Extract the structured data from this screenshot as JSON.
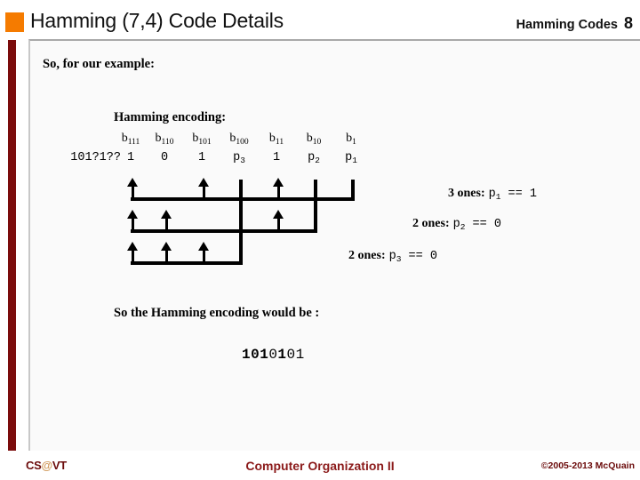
{
  "header": {
    "title": "Hamming (7,4) Code Details",
    "subject": "Hamming Codes",
    "slide_number": "8",
    "bullet_color": "#F57B00"
  },
  "accent": {
    "bar_color": "#7B0C0C"
  },
  "body": {
    "intro_text": "So, for our example:",
    "encoding_label": "Hamming encoding:",
    "conclusion_text": "So the Hamming encoding would be :"
  },
  "bit_table": {
    "source_pattern": "101?1??",
    "labels": [
      {
        "base": "b",
        "sub": "111"
      },
      {
        "base": "b",
        "sub": "110"
      },
      {
        "base": "b",
        "sub": "101"
      },
      {
        "base": "b",
        "sub": "100"
      },
      {
        "base": "b",
        "sub": "11"
      },
      {
        "base": "b",
        "sub": "10"
      },
      {
        "base": "b",
        "sub": "1"
      }
    ],
    "values": [
      {
        "base": "1",
        "sub": ""
      },
      {
        "base": "0",
        "sub": ""
      },
      {
        "base": "1",
        "sub": ""
      },
      {
        "base": "p",
        "sub": "3"
      },
      {
        "base": "1",
        "sub": ""
      },
      {
        "base": "p",
        "sub": "2"
      },
      {
        "base": "p",
        "sub": "1"
      }
    ]
  },
  "parity_rows": [
    {
      "name": "p1",
      "count_text": "3 ones:",
      "equation_parity": "p",
      "equation_sub": "1",
      "equation_op": "==",
      "equation_result": "1",
      "arrow_columns": [
        1,
        3,
        5
      ],
      "tick_columns": [
        4,
        7
      ]
    },
    {
      "name": "p2",
      "count_text": "2 ones:",
      "equation_parity": "p",
      "equation_sub": "2",
      "equation_op": "==",
      "equation_result": "0",
      "arrow_columns": [
        1,
        2,
        5
      ],
      "tick_columns": [
        4,
        6
      ]
    },
    {
      "name": "p3",
      "count_text": "2 ones:",
      "equation_parity": "p",
      "equation_sub": "3",
      "equation_op": "==",
      "equation_result": "0",
      "arrow_columns": [
        1,
        2,
        3
      ],
      "tick_columns": [
        4
      ]
    }
  ],
  "result": {
    "segments": [
      {
        "text": "101",
        "bold": true
      },
      {
        "text": "0",
        "bold": false
      },
      {
        "text": "1",
        "bold": true
      },
      {
        "text": "01",
        "bold": false
      }
    ],
    "full_text": "1010101"
  },
  "footer": {
    "logo_prefix": "CS",
    "logo_at": "@",
    "logo_suffix": "VT",
    "course": "Computer Organization II",
    "copyright": "©2005-2013 McQuain"
  }
}
